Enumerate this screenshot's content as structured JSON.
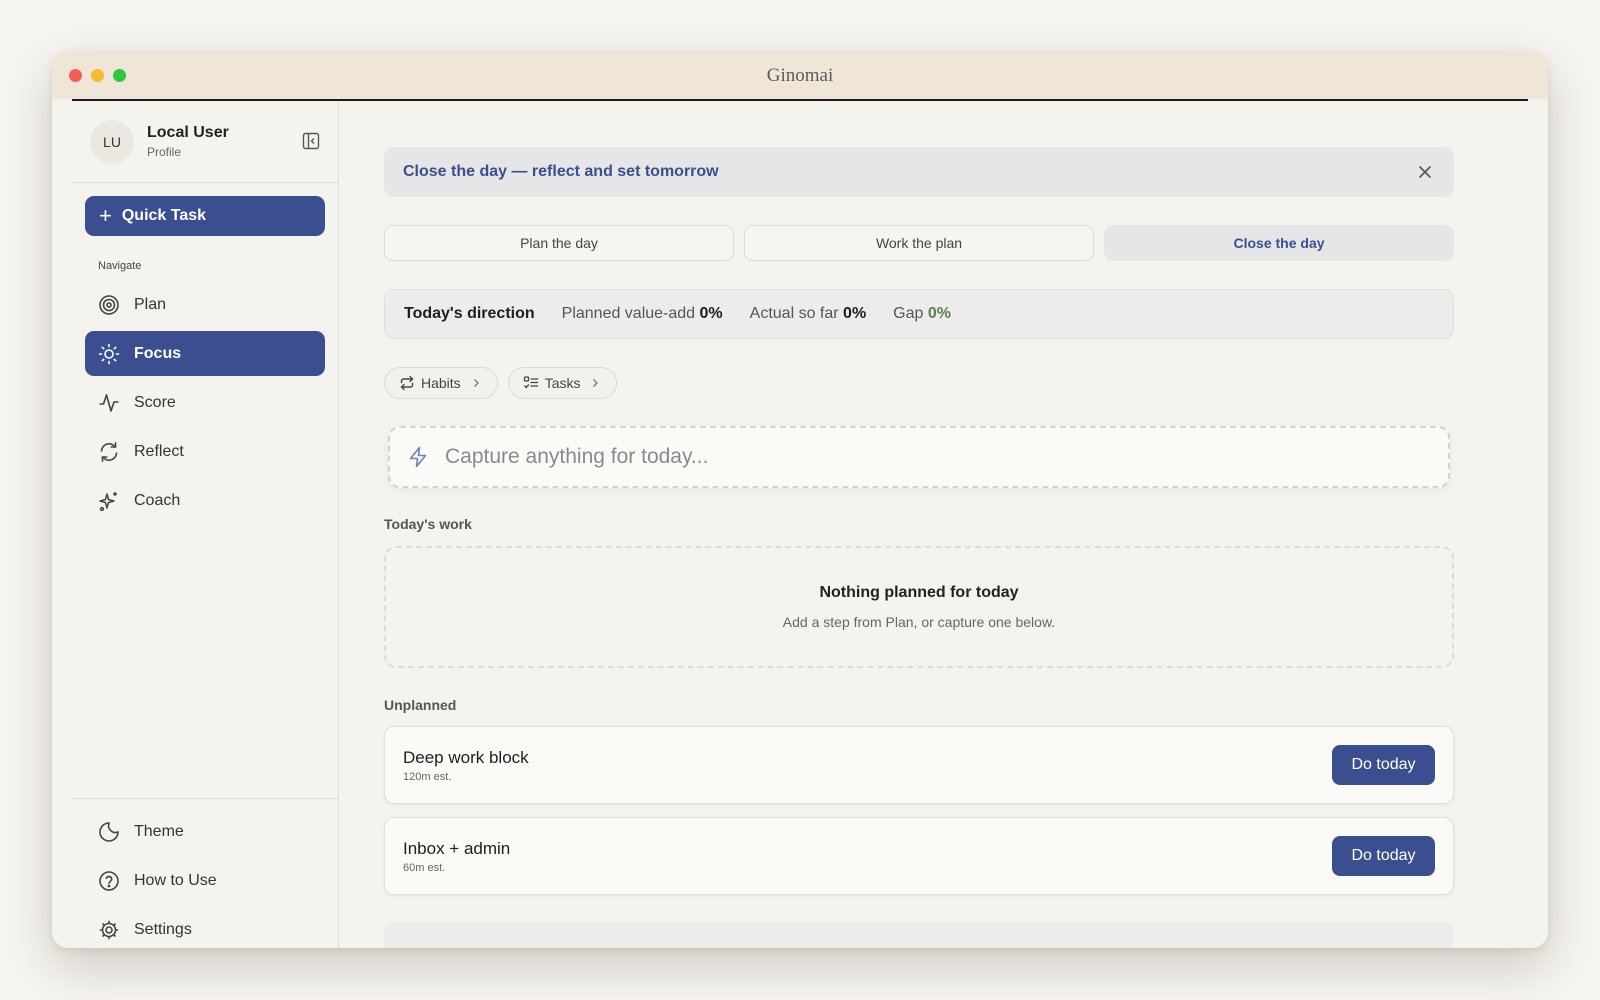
{
  "window": {
    "title": "Ginomai"
  },
  "profile": {
    "initials": "LU",
    "name": "Local User",
    "subtitle": "Profile"
  },
  "sidebar": {
    "quick_task_label": "Quick Task",
    "nav_label": "Navigate",
    "items": [
      {
        "label": "Plan",
        "icon": "target-icon",
        "active": false
      },
      {
        "label": "Focus",
        "icon": "sun-icon",
        "active": true
      },
      {
        "label": "Score",
        "icon": "activity-icon",
        "active": false
      },
      {
        "label": "Reflect",
        "icon": "refresh-icon",
        "active": false
      },
      {
        "label": "Coach",
        "icon": "sparkles-icon",
        "active": false
      }
    ],
    "bottom_items": [
      {
        "label": "Theme",
        "icon": "moon-icon"
      },
      {
        "label": "How to Use",
        "icon": "help-icon"
      },
      {
        "label": "Settings",
        "icon": "gear-icon"
      }
    ]
  },
  "banner": {
    "text": "Close the day — reflect and set tomorrow"
  },
  "phases": [
    {
      "label": "Plan the day",
      "active": false
    },
    {
      "label": "Work the plan",
      "active": false
    },
    {
      "label": "Close the day",
      "active": true
    }
  ],
  "direction": {
    "heading": "Today's direction",
    "planned_label": "Planned value-add",
    "planned_value": "0%",
    "actual_label": "Actual so far",
    "actual_value": "0%",
    "gap_label": "Gap",
    "gap_value": "0%"
  },
  "chips": [
    {
      "label": "Habits",
      "icon": "repeat-icon"
    },
    {
      "label": "Tasks",
      "icon": "list-icon"
    }
  ],
  "capture": {
    "placeholder": "Capture anything for today..."
  },
  "todays_work": {
    "heading": "Today's work",
    "empty_title": "Nothing planned for today",
    "empty_subtitle": "Add a step from Plan, or capture one below."
  },
  "unplanned": {
    "heading": "Unplanned",
    "tasks": [
      {
        "name": "Deep work block",
        "estimate": "120m est.",
        "action": "Do today"
      },
      {
        "name": "Inbox + admin",
        "estimate": "60m est.",
        "action": "Do today"
      }
    ]
  },
  "colors": {
    "accent": "#3b4e8f",
    "gap": "#5f7c58",
    "titlebar": "#efe6d8"
  }
}
